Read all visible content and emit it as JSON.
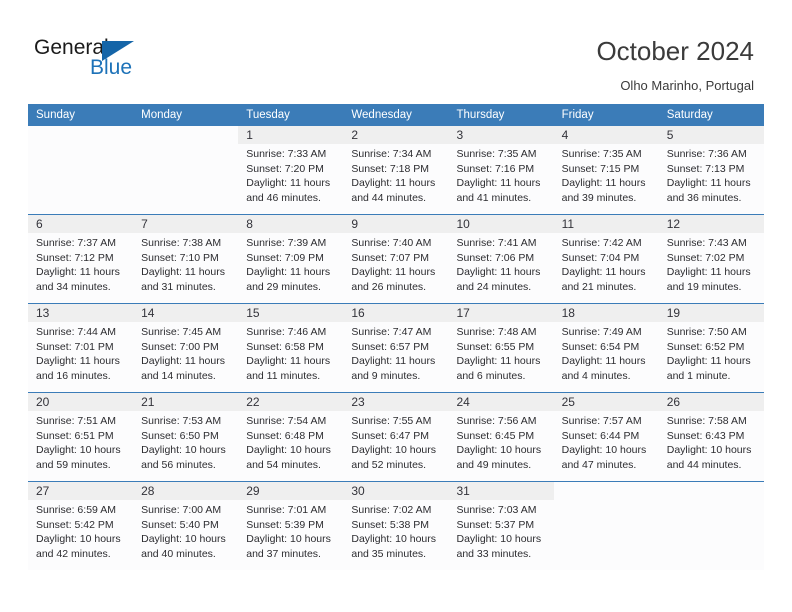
{
  "logo": {
    "word_one": "General",
    "word_two": "Blue",
    "accent_color": "#1565a8"
  },
  "header": {
    "title": "October 2024",
    "location": "Olho Marinho, Portugal",
    "header_bg": "#3b7cb8",
    "header_text_color": "#ffffff"
  },
  "weekdays": [
    "Sunday",
    "Monday",
    "Tuesday",
    "Wednesday",
    "Thursday",
    "Friday",
    "Saturday"
  ],
  "labels": {
    "sunrise_prefix": "Sunrise:",
    "sunset_prefix": "Sunset:",
    "daylight_prefix": "Daylight:"
  },
  "weeks": [
    {
      "days": [
        {
          "date": "",
          "sunrise": "",
          "sunset": "",
          "daylight_line1": "",
          "daylight_line2": ""
        },
        {
          "date": "",
          "sunrise": "",
          "sunset": "",
          "daylight_line1": "",
          "daylight_line2": ""
        },
        {
          "date": "1",
          "sunrise": "Sunrise: 7:33 AM",
          "sunset": "Sunset: 7:20 PM",
          "daylight_line1": "Daylight: 11 hours",
          "daylight_line2": "and 46 minutes."
        },
        {
          "date": "2",
          "sunrise": "Sunrise: 7:34 AM",
          "sunset": "Sunset: 7:18 PM",
          "daylight_line1": "Daylight: 11 hours",
          "daylight_line2": "and 44 minutes."
        },
        {
          "date": "3",
          "sunrise": "Sunrise: 7:35 AM",
          "sunset": "Sunset: 7:16 PM",
          "daylight_line1": "Daylight: 11 hours",
          "daylight_line2": "and 41 minutes."
        },
        {
          "date": "4",
          "sunrise": "Sunrise: 7:35 AM",
          "sunset": "Sunset: 7:15 PM",
          "daylight_line1": "Daylight: 11 hours",
          "daylight_line2": "and 39 minutes."
        },
        {
          "date": "5",
          "sunrise": "Sunrise: 7:36 AM",
          "sunset": "Sunset: 7:13 PM",
          "daylight_line1": "Daylight: 11 hours",
          "daylight_line2": "and 36 minutes."
        }
      ]
    },
    {
      "days": [
        {
          "date": "6",
          "sunrise": "Sunrise: 7:37 AM",
          "sunset": "Sunset: 7:12 PM",
          "daylight_line1": "Daylight: 11 hours",
          "daylight_line2": "and 34 minutes."
        },
        {
          "date": "7",
          "sunrise": "Sunrise: 7:38 AM",
          "sunset": "Sunset: 7:10 PM",
          "daylight_line1": "Daylight: 11 hours",
          "daylight_line2": "and 31 minutes."
        },
        {
          "date": "8",
          "sunrise": "Sunrise: 7:39 AM",
          "sunset": "Sunset: 7:09 PM",
          "daylight_line1": "Daylight: 11 hours",
          "daylight_line2": "and 29 minutes."
        },
        {
          "date": "9",
          "sunrise": "Sunrise: 7:40 AM",
          "sunset": "Sunset: 7:07 PM",
          "daylight_line1": "Daylight: 11 hours",
          "daylight_line2": "and 26 minutes."
        },
        {
          "date": "10",
          "sunrise": "Sunrise: 7:41 AM",
          "sunset": "Sunset: 7:06 PM",
          "daylight_line1": "Daylight: 11 hours",
          "daylight_line2": "and 24 minutes."
        },
        {
          "date": "11",
          "sunrise": "Sunrise: 7:42 AM",
          "sunset": "Sunset: 7:04 PM",
          "daylight_line1": "Daylight: 11 hours",
          "daylight_line2": "and 21 minutes."
        },
        {
          "date": "12",
          "sunrise": "Sunrise: 7:43 AM",
          "sunset": "Sunset: 7:02 PM",
          "daylight_line1": "Daylight: 11 hours",
          "daylight_line2": "and 19 minutes."
        }
      ]
    },
    {
      "days": [
        {
          "date": "13",
          "sunrise": "Sunrise: 7:44 AM",
          "sunset": "Sunset: 7:01 PM",
          "daylight_line1": "Daylight: 11 hours",
          "daylight_line2": "and 16 minutes."
        },
        {
          "date": "14",
          "sunrise": "Sunrise: 7:45 AM",
          "sunset": "Sunset: 7:00 PM",
          "daylight_line1": "Daylight: 11 hours",
          "daylight_line2": "and 14 minutes."
        },
        {
          "date": "15",
          "sunrise": "Sunrise: 7:46 AM",
          "sunset": "Sunset: 6:58 PM",
          "daylight_line1": "Daylight: 11 hours",
          "daylight_line2": "and 11 minutes."
        },
        {
          "date": "16",
          "sunrise": "Sunrise: 7:47 AM",
          "sunset": "Sunset: 6:57 PM",
          "daylight_line1": "Daylight: 11 hours",
          "daylight_line2": "and 9 minutes."
        },
        {
          "date": "17",
          "sunrise": "Sunrise: 7:48 AM",
          "sunset": "Sunset: 6:55 PM",
          "daylight_line1": "Daylight: 11 hours",
          "daylight_line2": "and 6 minutes."
        },
        {
          "date": "18",
          "sunrise": "Sunrise: 7:49 AM",
          "sunset": "Sunset: 6:54 PM",
          "daylight_line1": "Daylight: 11 hours",
          "daylight_line2": "and 4 minutes."
        },
        {
          "date": "19",
          "sunrise": "Sunrise: 7:50 AM",
          "sunset": "Sunset: 6:52 PM",
          "daylight_line1": "Daylight: 11 hours",
          "daylight_line2": "and 1 minute."
        }
      ]
    },
    {
      "days": [
        {
          "date": "20",
          "sunrise": "Sunrise: 7:51 AM",
          "sunset": "Sunset: 6:51 PM",
          "daylight_line1": "Daylight: 10 hours",
          "daylight_line2": "and 59 minutes."
        },
        {
          "date": "21",
          "sunrise": "Sunrise: 7:53 AM",
          "sunset": "Sunset: 6:50 PM",
          "daylight_line1": "Daylight: 10 hours",
          "daylight_line2": "and 56 minutes."
        },
        {
          "date": "22",
          "sunrise": "Sunrise: 7:54 AM",
          "sunset": "Sunset: 6:48 PM",
          "daylight_line1": "Daylight: 10 hours",
          "daylight_line2": "and 54 minutes."
        },
        {
          "date": "23",
          "sunrise": "Sunrise: 7:55 AM",
          "sunset": "Sunset: 6:47 PM",
          "daylight_line1": "Daylight: 10 hours",
          "daylight_line2": "and 52 minutes."
        },
        {
          "date": "24",
          "sunrise": "Sunrise: 7:56 AM",
          "sunset": "Sunset: 6:45 PM",
          "daylight_line1": "Daylight: 10 hours",
          "daylight_line2": "and 49 minutes."
        },
        {
          "date": "25",
          "sunrise": "Sunrise: 7:57 AM",
          "sunset": "Sunset: 6:44 PM",
          "daylight_line1": "Daylight: 10 hours",
          "daylight_line2": "and 47 minutes."
        },
        {
          "date": "26",
          "sunrise": "Sunrise: 7:58 AM",
          "sunset": "Sunset: 6:43 PM",
          "daylight_line1": "Daylight: 10 hours",
          "daylight_line2": "and 44 minutes."
        }
      ]
    },
    {
      "days": [
        {
          "date": "27",
          "sunrise": "Sunrise: 6:59 AM",
          "sunset": "Sunset: 5:42 PM",
          "daylight_line1": "Daylight: 10 hours",
          "daylight_line2": "and 42 minutes."
        },
        {
          "date": "28",
          "sunrise": "Sunrise: 7:00 AM",
          "sunset": "Sunset: 5:40 PM",
          "daylight_line1": "Daylight: 10 hours",
          "daylight_line2": "and 40 minutes."
        },
        {
          "date": "29",
          "sunrise": "Sunrise: 7:01 AM",
          "sunset": "Sunset: 5:39 PM",
          "daylight_line1": "Daylight: 10 hours",
          "daylight_line2": "and 37 minutes."
        },
        {
          "date": "30",
          "sunrise": "Sunrise: 7:02 AM",
          "sunset": "Sunset: 5:38 PM",
          "daylight_line1": "Daylight: 10 hours",
          "daylight_line2": "and 35 minutes."
        },
        {
          "date": "31",
          "sunrise": "Sunrise: 7:03 AM",
          "sunset": "Sunset: 5:37 PM",
          "daylight_line1": "Daylight: 10 hours",
          "daylight_line2": "and 33 minutes."
        },
        {
          "date": "",
          "sunrise": "",
          "sunset": "",
          "daylight_line1": "",
          "daylight_line2": ""
        },
        {
          "date": "",
          "sunrise": "",
          "sunset": "",
          "daylight_line1": "",
          "daylight_line2": ""
        }
      ]
    }
  ]
}
